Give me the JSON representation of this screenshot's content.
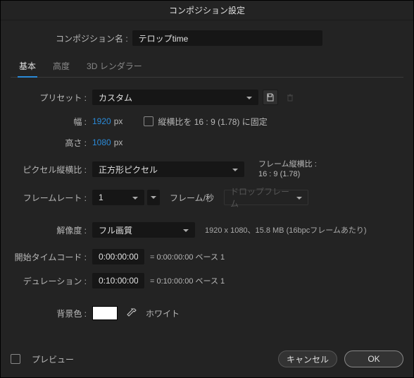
{
  "dialog": {
    "title": "コンポジション設定",
    "name_label": "コンポジション名 :",
    "name_value": "テロップtime"
  },
  "tabs": {
    "basic": "基本",
    "advanced": "高度",
    "renderer": "3D レンダラー"
  },
  "preset": {
    "label": "プリセット :",
    "value": "カスタム"
  },
  "dims": {
    "width_label": "幅 :",
    "width_value": "1920",
    "height_label": "高さ :",
    "height_value": "1080",
    "px": "px",
    "lock_label": "縦横比を 16 : 9 (1.78) に固定"
  },
  "par": {
    "label": "ピクセル縦横比 :",
    "value": "正方形ピクセル",
    "frame_ar_label": "フレーム縦横比 :",
    "frame_ar_value": "16 : 9 (1.78)"
  },
  "fps": {
    "label": "フレームレート :",
    "value": "1",
    "unit": "フレーム/秒",
    "drop": "ドロップフレーム"
  },
  "res": {
    "label": "解像度 :",
    "value": "フル画質",
    "info": "1920 x 1080、15.8 MB (16bpcフレームあたり)"
  },
  "start": {
    "label": "開始タイムコード :",
    "value": "0:00:00:00",
    "eq": "= 0:00:00:00  ベース 1"
  },
  "dur": {
    "label": "デュレーション :",
    "value": "0:10:00:00",
    "eq": "= 0:10:00:00  ベース 1"
  },
  "bg": {
    "label": "背景色 :",
    "name": "ホワイト",
    "color": "#ffffff"
  },
  "footer": {
    "preview": "プレビュー",
    "cancel": "キャンセル",
    "ok": "OK"
  }
}
